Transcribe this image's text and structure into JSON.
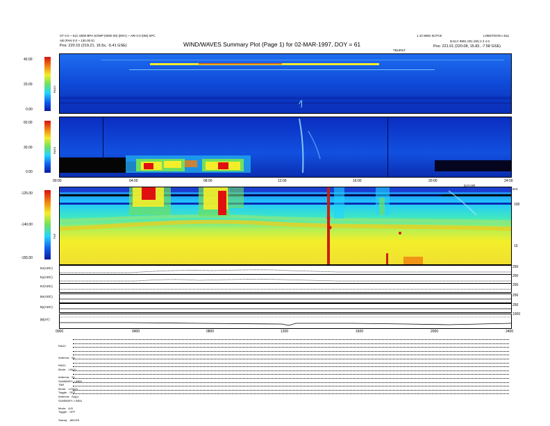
{
  "header": {
    "title": "WIND/WAVES Summary Plot (Page 1) for 02-MAR-1997, DOY = 61",
    "left_line1": "CF 0.0 ~ 61C 0000 BPA SOWP (0000 00) (ERA) ~ ARI 0.0 (0M) SPC",
    "left_line2": "AB (PAN 0.0 ~ 130.00 E)",
    "left_pos_label": "Pos:",
    "left_pos_value": "220.15 (219.21, 16.5s, -5.41 GSE)",
    "right_line1": "1.10 WED 0UTCE",
    "right_line2": "DAILY  9901 001 (00) 2 3 4 0",
    "right_corner": "LOBSTOON n ka1",
    "right_pos_label": "Pos:",
    "right_pos_value": "221.01 (220.08, 15.82, -7.58 GSE)",
    "mid_label": "TBURST"
  },
  "chart_data": [
    {
      "type": "heatmap",
      "name": "RAD2",
      "ylabel": "RAD2",
      "ylim": [
        0,
        40
      ],
      "yticks": [
        "40.00",
        "20.00",
        "0.00"
      ]
    },
    {
      "type": "heatmap",
      "name": "RAD1",
      "ylabel": "RAD1",
      "ylim": [
        0,
        60
      ],
      "yticks": [
        "60.00",
        "30.00",
        "0.00"
      ]
    },
    {
      "type": "heatmap",
      "name": "TNR",
      "ylabel": "TNR",
      "ylim": [
        -155,
        -125
      ],
      "yticks": [
        "-125.00",
        "-140.00",
        "-155.00"
      ],
      "right_ticks": [
        "100",
        "10"
      ]
    },
    {
      "type": "line",
      "name": "traces",
      "series": [
        {
          "name": "Ex(ADC)"
        },
        {
          "name": "Ey(ADC)"
        },
        {
          "name": "Ez(ADC)"
        },
        {
          "name": "Bx(ADC)"
        },
        {
          "name": "By(ADC)"
        },
        {
          "name": "|B|(nT)"
        }
      ]
    }
  ],
  "time_axis_top": [
    "00:00",
    "04:00",
    "08:00",
    "12:00",
    "16:00",
    "20:00",
    "24:00"
  ],
  "time_axis_bottom": [
    "0000",
    "0400",
    "0800",
    "1200",
    "1600",
    "2000",
    "2400"
  ],
  "axis_unit_label": "DAY:HR",
  "tnr_right_label": "kHz",
  "right_scale_traces": [
    "250",
    "250",
    "250",
    "250",
    "250",
    "1000"
  ],
  "settings": {
    "rad2": [
      "RAD2",
      "Antenna:   Ey",
      "Mode:   LIN(1)",
      "SUMMARY: LINEA",
      "Toggle:   OFF"
    ],
    "rad1": [
      "RAD1",
      "Antenna:   Ey",
      "Mode:   LOG(2)",
      "SUMMARY: LINEA",
      "Toggle:   OFF"
    ],
    "tnr": [
      "TNR",
      "Antenna:   Ey(p)",
      "Mode:   A-B",
      "Sweep:   ABCDE"
    ]
  },
  "colors": {
    "bg_blue": "#0a3cc8",
    "dark_blue": "#061a8c",
    "cyan": "#22d4ff",
    "yellow": "#f4ee2a",
    "red": "#e01010"
  }
}
